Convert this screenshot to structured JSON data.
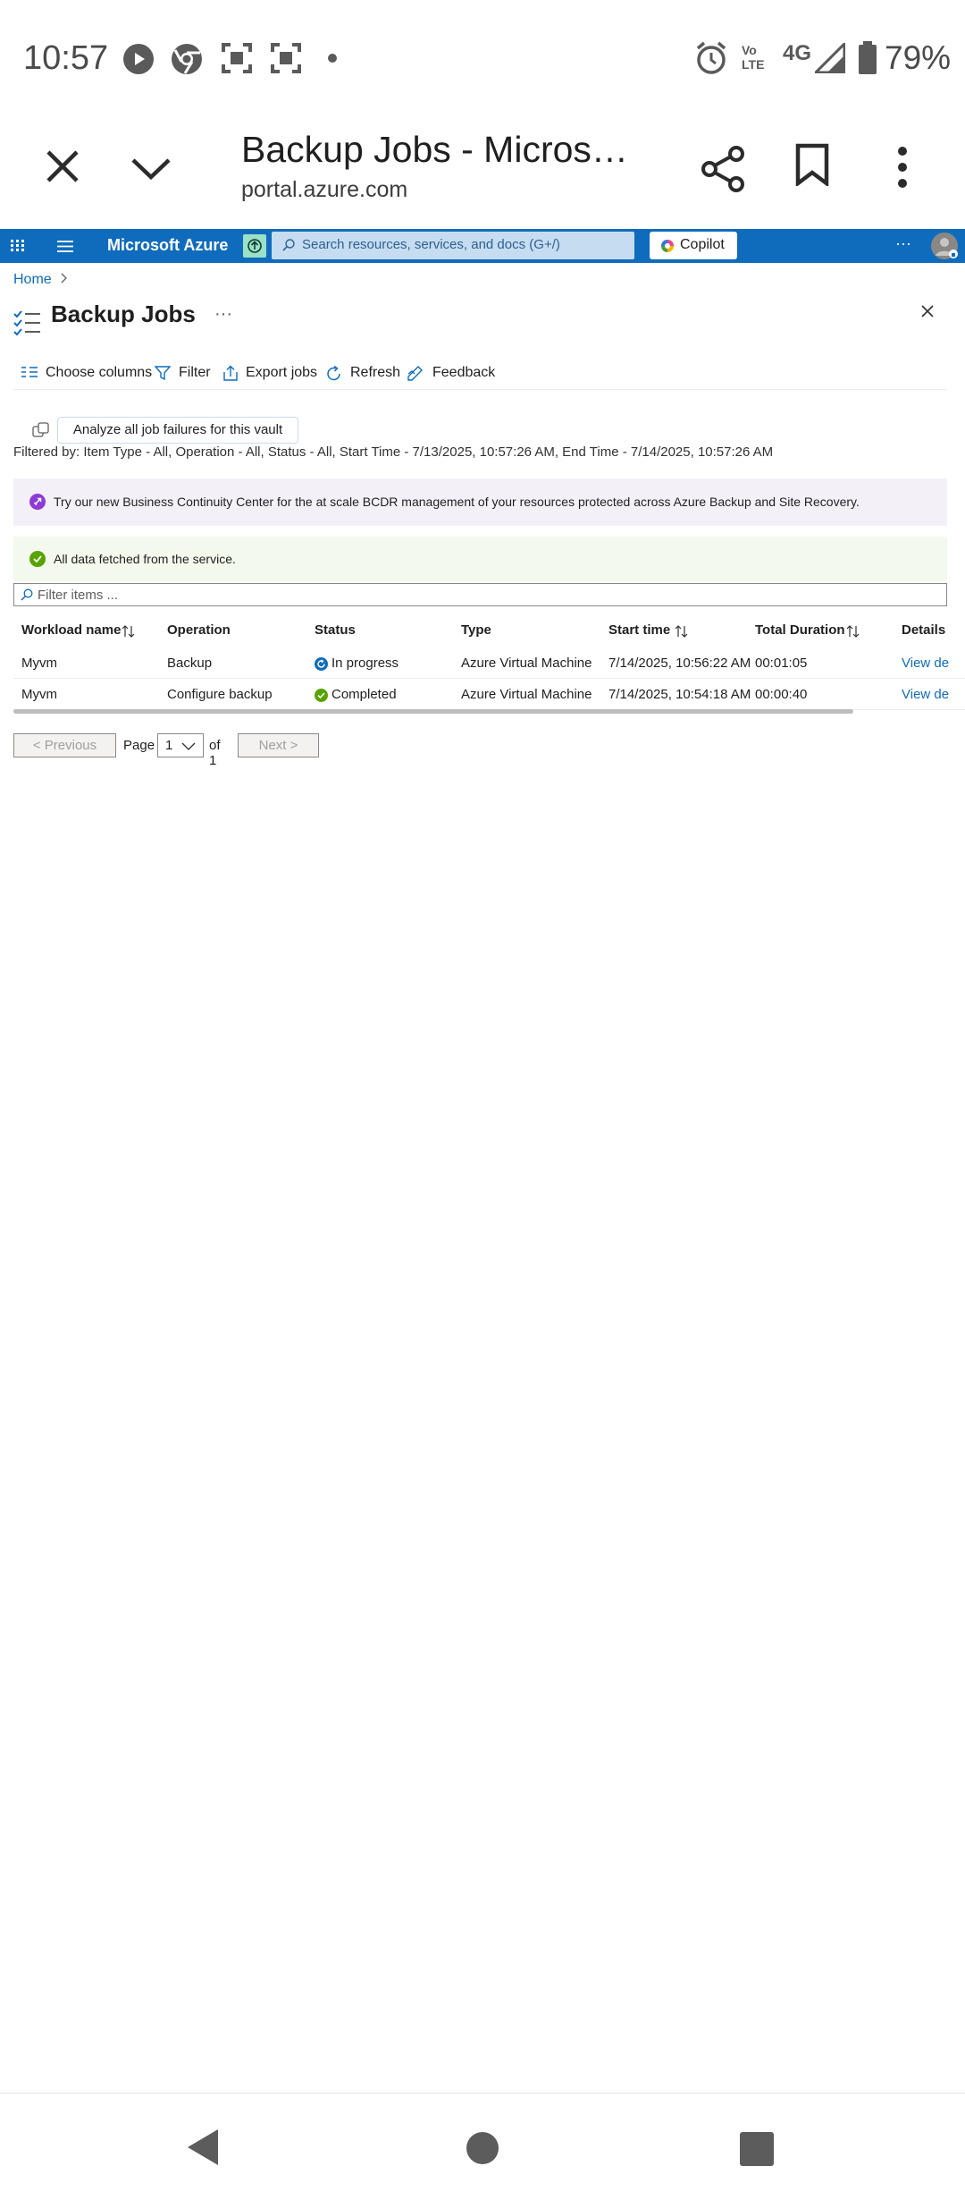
{
  "status_bar": {
    "time": "10:57",
    "network": "4G",
    "volte": "Vo LTE",
    "battery": "79%"
  },
  "tab_bar": {
    "title": "Backup Jobs - Micros…",
    "url": "portal.azure.com"
  },
  "azure": {
    "brand": "Microsoft Azure",
    "search_placeholder": "Search resources, services, and docs (G+/)",
    "copilot_label": "Copilot",
    "more": "···",
    "breadcrumb": "Home",
    "page_title": "Backup Jobs",
    "title_more": "···",
    "toolbar": {
      "choose_columns": "Choose columns",
      "filter": "Filter",
      "export": "Export jobs",
      "refresh": "Refresh",
      "feedback": "Feedback"
    },
    "analyze_label": "Analyze all job failures for this vault",
    "filtered_by": "Filtered by: Item Type - All, Operation - All, Status - All, Start Time - 7/13/2025, 10:57:26 AM, End Time - 7/14/2025, 10:57:26 AM",
    "promo_banner": "Try our new Business Continuity Center for the at scale BCDR management of your resources protected across Azure Backup and Site Recovery.",
    "success_banner": "All data fetched from the service.",
    "filter_placeholder": "Filter items ...",
    "columns": {
      "workload": "Workload name",
      "operation": "Operation",
      "status": "Status",
      "type": "Type",
      "start": "Start time",
      "duration": "Total Duration",
      "details": "Details"
    },
    "rows": [
      {
        "workload": "Myvm",
        "operation": "Backup",
        "status": "In progress",
        "type": "Azure Virtual Machine",
        "start": "7/14/2025, 10:56:22 AM",
        "duration": "00:01:05",
        "details": "View de"
      },
      {
        "workload": "Myvm",
        "operation": "Configure backup",
        "status": "Completed",
        "type": "Azure Virtual Machine",
        "start": "7/14/2025, 10:54:18 AM",
        "duration": "00:00:40",
        "details": "View de"
      }
    ],
    "pager": {
      "previous": "< Previous",
      "page_label": "Page",
      "page_value": "1",
      "of_label": "of 1",
      "next": "Next >"
    }
  },
  "colors": {
    "azure_blue": "#0f6cbd",
    "success_green": "#57a300",
    "promo_purple": "#8e3bd6"
  }
}
